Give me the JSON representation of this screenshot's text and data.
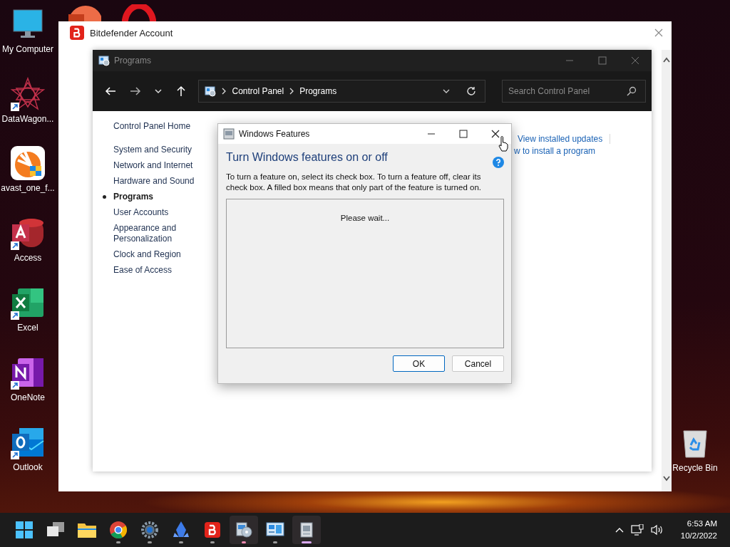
{
  "desktop_icons": [
    {
      "label": "My Computer",
      "kind": "monitor",
      "shortcut": false
    },
    {
      "label": "DataWagon...",
      "kind": "star",
      "shortcut": true
    },
    {
      "label": "avast_one_f...",
      "kind": "avast",
      "shortcut": false
    },
    {
      "label": "Access",
      "kind": "access",
      "shortcut": true
    },
    {
      "label": "Excel",
      "kind": "excel",
      "shortcut": true
    },
    {
      "label": "OneNote",
      "kind": "onenote",
      "shortcut": true
    },
    {
      "label": "Outlook",
      "kind": "outlook",
      "shortcut": true
    }
  ],
  "hidden_icons": [
    {
      "kind": "powerpoint"
    },
    {
      "kind": "opera"
    }
  ],
  "recycle_bin": {
    "label": "Recycle Bin"
  },
  "bitdefender_window": {
    "title": "Bitdefender Account"
  },
  "programs_window": {
    "title": "Programs",
    "breadcrumb": [
      "Control Panel",
      "Programs"
    ],
    "search": {
      "placeholder": "Search Control Panel"
    },
    "nav": [
      {
        "label": "Control Panel Home",
        "selected": false
      },
      {
        "label": "System and Security",
        "selected": false
      },
      {
        "label": "Network and Internet",
        "selected": false
      },
      {
        "label": "Hardware and Sound",
        "selected": false
      },
      {
        "label": "Programs",
        "selected": true
      },
      {
        "label": "User Accounts",
        "selected": false
      },
      {
        "label": "Appearance and Personalization",
        "selected": false
      },
      {
        "label": "Clock and Region",
        "selected": false
      },
      {
        "label": "Ease of Access",
        "selected": false
      }
    ],
    "links": [
      "View installed updates",
      "w to install a program"
    ]
  },
  "features_dialog": {
    "title": "Windows Features",
    "heading": "Turn Windows features on or off",
    "description": "To turn a feature on, select its check box. To turn a feature off, clear its check box. A filled box means that only part of the feature is turned on.",
    "status": "Please wait...",
    "buttons": [
      {
        "label": "OK",
        "default": true
      },
      {
        "label": "Cancel",
        "default": false
      }
    ]
  },
  "taskbar": {
    "apps": [
      {
        "kind": "start",
        "running": false,
        "selected": false
      },
      {
        "kind": "taskview",
        "running": false,
        "selected": false
      },
      {
        "kind": "folder",
        "running": false,
        "selected": false
      },
      {
        "kind": "chrome",
        "running": true,
        "selected": false
      },
      {
        "kind": "settings",
        "running": true,
        "selected": false
      },
      {
        "kind": "crystal",
        "running": true,
        "selected": false
      },
      {
        "kind": "bitdefender",
        "running": true,
        "selected": false
      },
      {
        "kind": "disc",
        "running": true,
        "selected": true
      },
      {
        "kind": "panel",
        "running": true,
        "selected": false
      },
      {
        "kind": "features",
        "running": true,
        "selected": true
      }
    ],
    "clock": {
      "time": "6:53 AM",
      "date": "10/2/2022"
    }
  }
}
